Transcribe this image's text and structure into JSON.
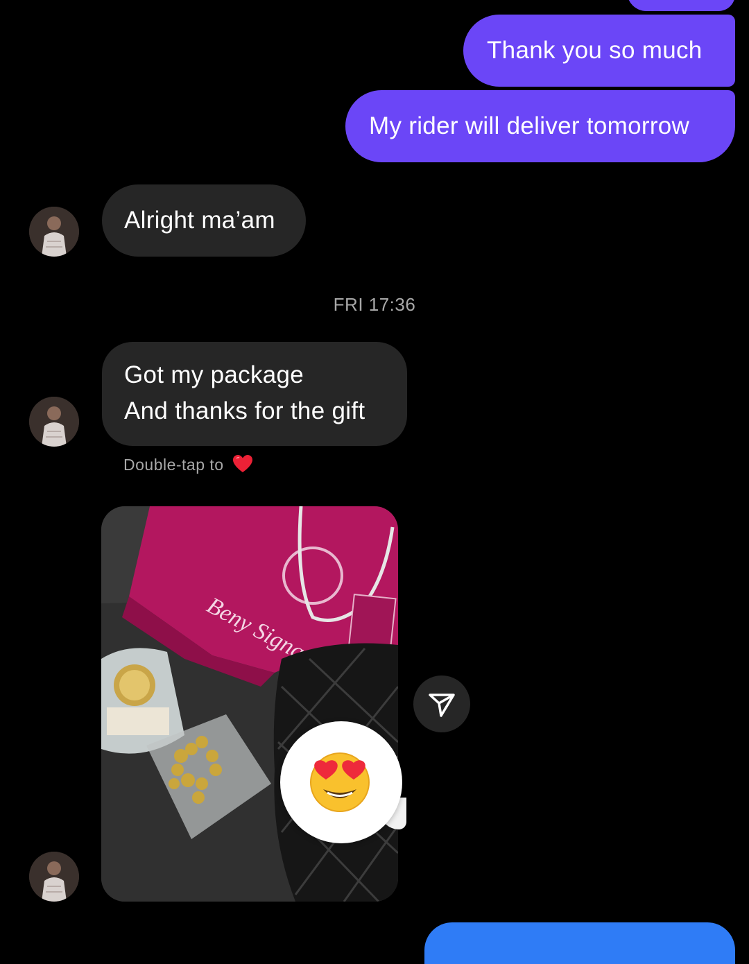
{
  "messages": {
    "sent_1": "Thank you so much",
    "sent_2": "My rider will deliver tomorrow",
    "recv_1": "Alright ma’am",
    "recv_2_line1": "Got my package",
    "recv_2_line2": "And thanks for the gift"
  },
  "timestamp": "FRI 17:36",
  "reaction_hint": {
    "text": "Double-tap to",
    "icon": "red-heart-icon"
  },
  "photo": {
    "description_icons": [
      "gift-bag",
      "watch",
      "gold-necklace",
      "black-quilted-bag"
    ],
    "bag_text": "Beny Signature",
    "reaction_emoji": "smiling-face-with-heart-eyes"
  },
  "colors": {
    "sent_bubble": "#6b46f7",
    "received_bubble": "#262626",
    "background": "#000000",
    "bottom_bubble": "#2f7cf6"
  }
}
